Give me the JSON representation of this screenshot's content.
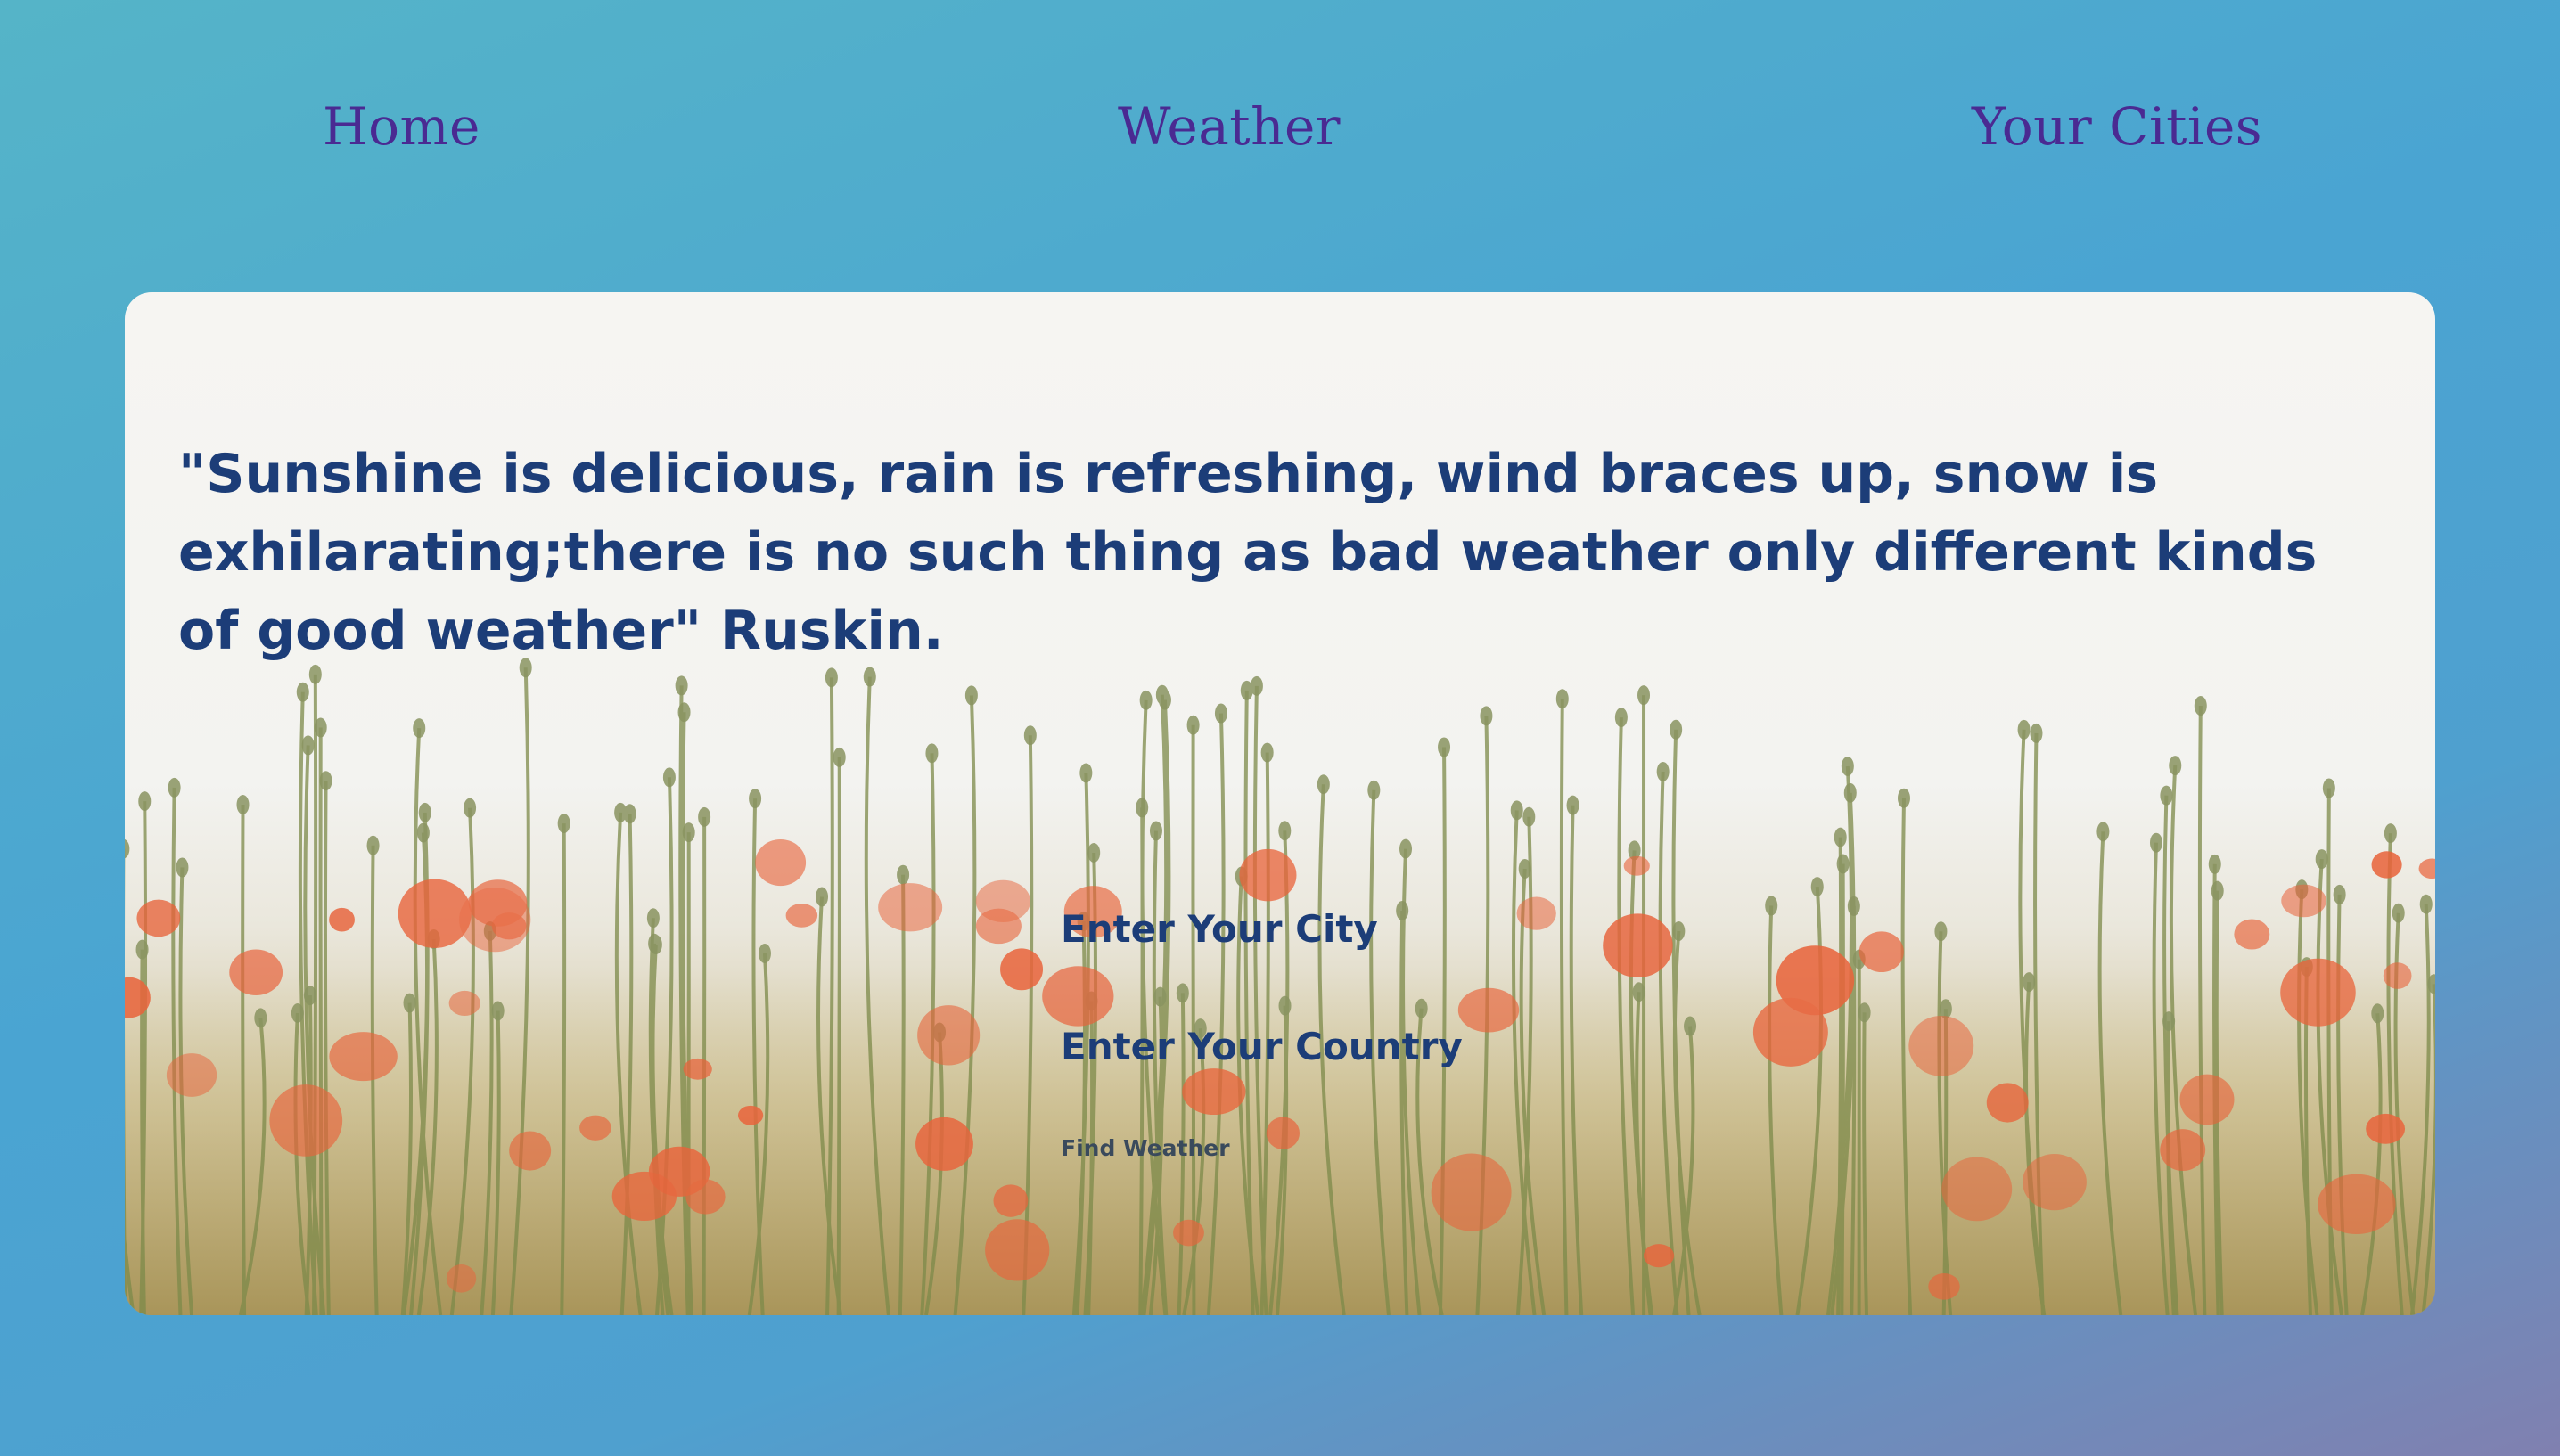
{
  "nav": {
    "home": "Home",
    "weather": "Weather",
    "cities": "Your Cities"
  },
  "hero": {
    "quote": "\"Sunshine is delicious, rain is refreshing, wind braces up, snow is exhilarating;there is no such thing as bad weather only different kinds of good weather\" Ruskin."
  },
  "form": {
    "city_label": "Enter Your City",
    "country_label": "Enter Your Country",
    "submit_label": "Find Weather"
  },
  "colors": {
    "nav_text": "#4a2a92",
    "heading_text": "#1c3d78",
    "poppy": "#e8643c"
  }
}
